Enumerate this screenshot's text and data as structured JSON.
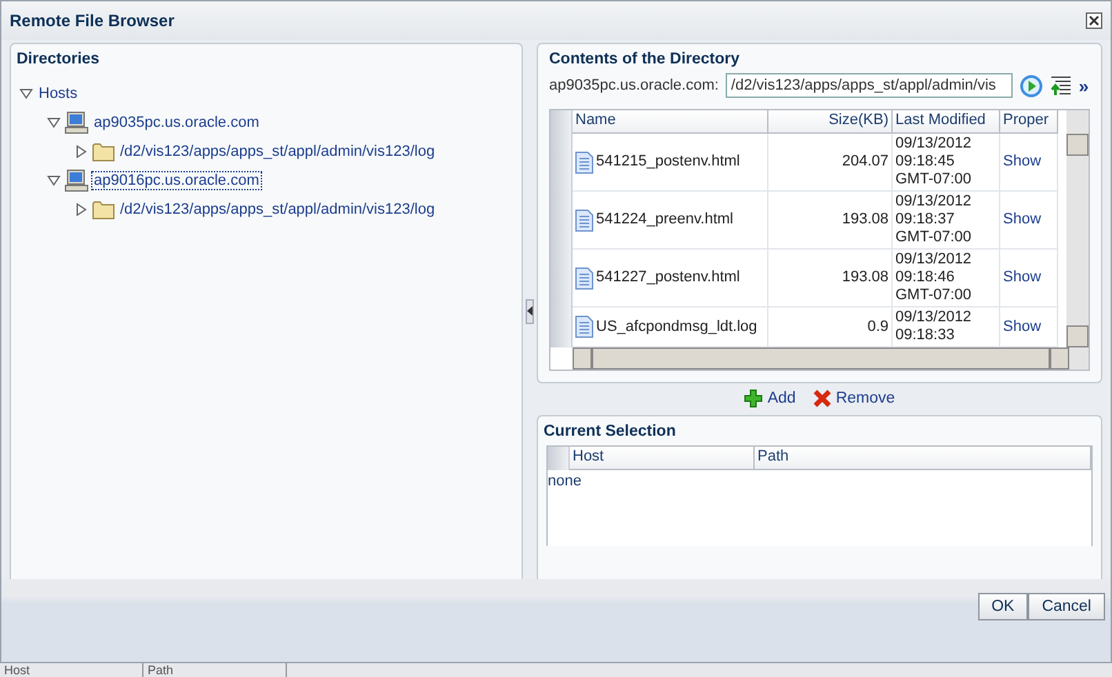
{
  "dialog": {
    "title": "Remote File Browser"
  },
  "directories": {
    "title": "Directories",
    "tree": [
      {
        "label": "Hosts",
        "expanded": true,
        "selected": false,
        "children": [
          {
            "label": "ap9035pc.us.oracle.com",
            "kind": "host",
            "expanded": true,
            "selected": false,
            "children": [
              {
                "label": "/d2/vis123/apps/apps_st/appl/admin/vis123/log",
                "kind": "folder",
                "expanded": false,
                "selected": false
              }
            ]
          },
          {
            "label": "ap9016pc.us.oracle.com",
            "kind": "host",
            "expanded": true,
            "selected": true,
            "children": [
              {
                "label": "/d2/vis123/apps/apps_st/appl/admin/vis123/log",
                "kind": "folder",
                "expanded": false,
                "selected": false
              }
            ]
          }
        ]
      }
    ]
  },
  "contents": {
    "title": "Contents of the Directory",
    "host_label": "ap9035pc.us.oracle.com:",
    "path": {
      "value": "/d2/vis123/apps/apps_st/appl/admin/vis"
    },
    "more": "»",
    "table": {
      "columns": [
        "Name",
        "Size(KB)",
        "Last Modified",
        "Proper"
      ],
      "rows": [
        {
          "name": "541215_postenv.html",
          "size": "204.07",
          "modified": "09/13/2012 09:18:45 GMT-07:00",
          "properties": "Show"
        },
        {
          "name": "541224_preenv.html",
          "size": "193.08",
          "modified": "09/13/2012 09:18:37 GMT-07:00",
          "properties": "Show"
        },
        {
          "name": "541227_postenv.html",
          "size": "193.08",
          "modified": "09/13/2012 09:18:46 GMT-07:00",
          "properties": "Show"
        },
        {
          "name": "US_afcpondmsg_ldt.log",
          "size": "0.9",
          "modified": "09/13/2012 09:18:33",
          "properties": "Show"
        }
      ]
    }
  },
  "actions": [
    {
      "label": "Add",
      "kind": "add"
    },
    {
      "label": "Remove",
      "kind": "remove"
    }
  ],
  "selection": {
    "title": "Current Selection",
    "columns": [
      "Host",
      "Path"
    ],
    "empty_text": "none"
  },
  "buttons": [
    "OK",
    "Cancel"
  ],
  "background_columns": [
    "Host",
    "Path"
  ]
}
